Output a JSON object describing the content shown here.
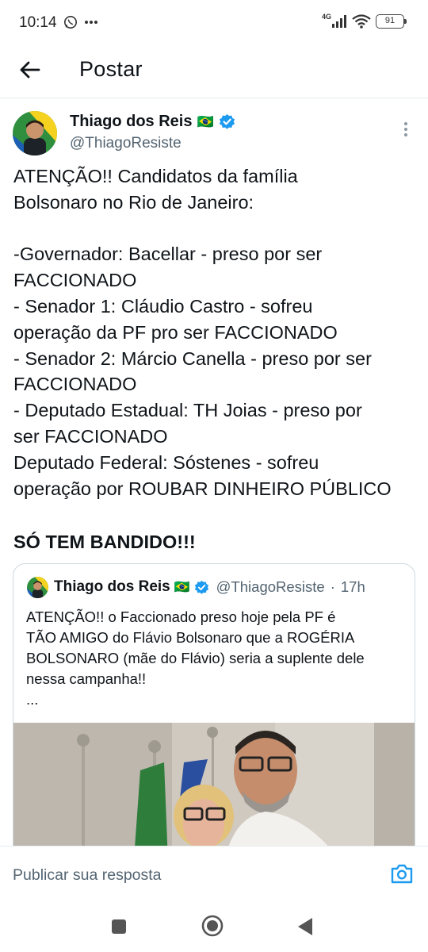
{
  "status_bar": {
    "time": "10:14",
    "network": "4G",
    "battery": "91",
    "icons": [
      "whatsapp-icon",
      "more-notifications-icon",
      "signal-icon",
      "wifi-icon",
      "battery-icon"
    ]
  },
  "app_bar": {
    "title": "Postar",
    "back_icon": "arrow-left-icon"
  },
  "tweet": {
    "author_name": "Thiago dos Reis",
    "author_flag": "🇧🇷",
    "author_handle": "@ThiagoResiste",
    "verified": true,
    "body": "ATENÇÃO!! Candidatos da família\nBolsonaro no Rio de Janeiro:\n\n-Governador: Bacellar - preso por ser\nFACCIONADO\n- Senador 1: Cláudio Castro - sofreu\noperação da PF pro ser FACCIONADO\n- Senador 2: Márcio Canella - preso por ser\nFACCIONADO\n- Deputado Estadual: TH Joias - preso por\nser FACCIONADO\nDeputado Federal: Sóstenes - sofreu\noperação por ROUBAR DINHEIRO PÚBLICO",
    "emphasis": "SÓ TEM BANDIDO!!!"
  },
  "quote": {
    "author_name": "Thiago dos Reis",
    "author_flag": "🇧🇷",
    "author_handle": "@ThiagoResiste",
    "separator": "·",
    "time": "17h",
    "body": "ATENÇÃO!! o Faccionado preso hoje pela PF é\nTÃO AMIGO do Flávio Bolsonaro que a ROGÉRIA\nBOLSONARO (mãe do Flávio) seria a suplente dele\nnessa campanha!!\n..."
  },
  "reply": {
    "placeholder": "Publicar sua resposta"
  },
  "colors": {
    "text": "#0f1419",
    "secondary_text": "#536471",
    "verified_blue": "#1d9bf0",
    "border": "#cfd9de"
  }
}
